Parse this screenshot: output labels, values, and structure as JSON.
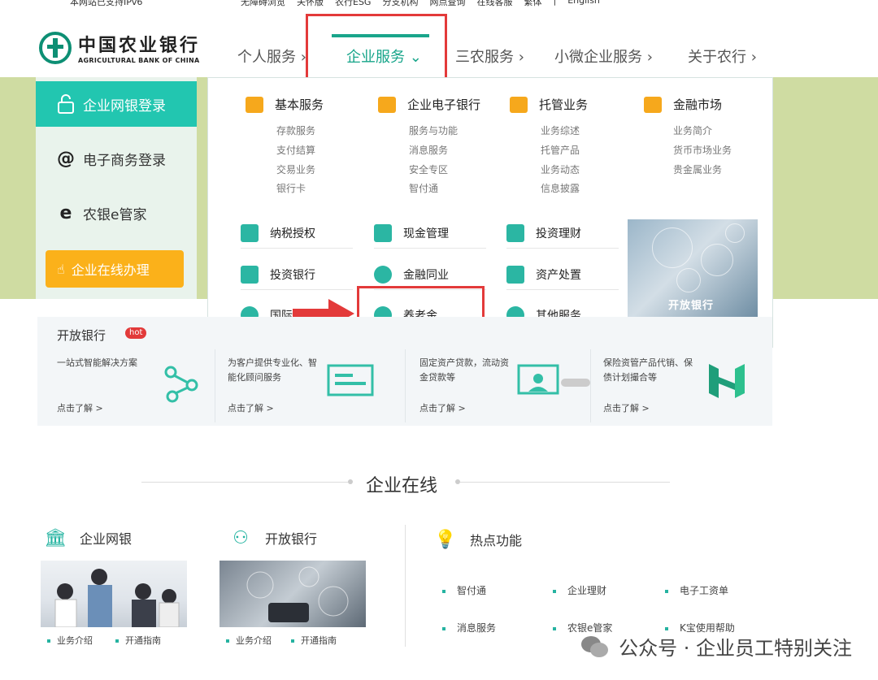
{
  "topbar": {
    "notice": "本网站已支持IPv6",
    "links": [
      "无障碍浏览",
      "关怀版",
      "农行ESG",
      "分支机构",
      "网点查询",
      "在线客服",
      "繁体",
      "|",
      "English"
    ]
  },
  "logo": {
    "cn": "中国农业银行",
    "en": "AGRICULTURAL BANK OF CHINA"
  },
  "nav": {
    "items": [
      "个人服务 ›",
      "企业服务 ⌄",
      "三农服务 ›",
      "小微企业服务 ›",
      "关于农行 ›"
    ],
    "active_index": 1
  },
  "sidebar": {
    "items": [
      "企业网银登录",
      "电子商务登录",
      "农银e管家"
    ],
    "online_button": "企业在线办理"
  },
  "dropdown": {
    "columns": [
      {
        "title": "基本服务",
        "subs": [
          "存款服务",
          "支付结算",
          "交易业务",
          "银行卡"
        ]
      },
      {
        "title": "企业电子银行",
        "subs": [
          "服务与功能",
          "消息服务",
          "安全专区",
          "智付通"
        ]
      },
      {
        "title": "托管业务",
        "subs": [
          "业务综述",
          "托管产品",
          "业务动态",
          "信息披露"
        ]
      },
      {
        "title": "金融市场",
        "subs": [
          "业务简介",
          "货币市场业务",
          "贵金属业务"
        ]
      }
    ],
    "grid": [
      [
        "纳税授权",
        "现金管理",
        "投资理财"
      ],
      [
        "投资银行",
        "金融同业",
        "资产处置"
      ],
      [
        "国际",
        "养老金",
        "其他服务"
      ]
    ],
    "image_label": "开放银行"
  },
  "open_bank": {
    "title": "开放银行",
    "badge": "hot",
    "cards": [
      {
        "text": "一站式智能解决方案",
        "more": "点击了解 >"
      },
      {
        "text": "为客户提供专业化、智能化顾问服务",
        "more": "点击了解 >"
      },
      {
        "text": "固定资产贷款，流动资金贷款等",
        "more": "点击了解 >"
      },
      {
        "text": "保险资管产品代销、保债计划撮合等",
        "more": "点击了解 >"
      }
    ]
  },
  "online": {
    "title": "企业在线",
    "blocks": [
      {
        "title": "企业网银",
        "links": [
          "业务介绍",
          "开通指南"
        ]
      },
      {
        "title": "开放银行",
        "links": [
          "业务介绍",
          "开通指南"
        ]
      }
    ],
    "hot": {
      "title": "热点功能",
      "links": [
        "智付通",
        "企业理财",
        "电子工资单",
        "消息服务",
        "农银e管家",
        "K宝使用帮助"
      ]
    }
  },
  "watermark": "公众号 · 企业员工特别关注",
  "colors": {
    "brand": "#19a58b",
    "accent_teal": "#22c6b0",
    "orange": "#fbb11a",
    "hero_bg": "#cfdca2",
    "highlight_red": "#e33a3a"
  }
}
